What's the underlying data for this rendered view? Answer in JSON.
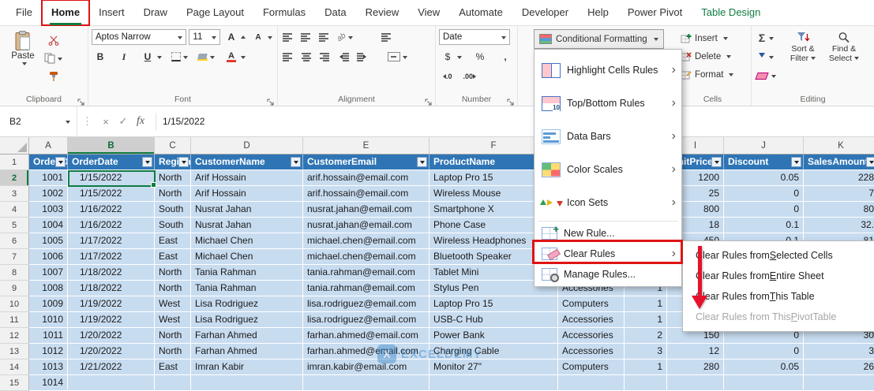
{
  "colors": {
    "accent_green": "#107C41",
    "annotation_red": "#DE1414",
    "table_header_blue": "#2F75B5",
    "row_fill": "#C8DCF0"
  },
  "glyphs": {
    "sigma": "Σ",
    "chevron": "›",
    "cancel": "×",
    "check": "✓",
    "dots": "⋮",
    "fx": "fx",
    "bold": "B",
    "italic": "I",
    "underline": "U",
    "dollar": "$",
    "percent": "%",
    "comma": ",",
    "inc_dec": ".0",
    "dec_dec": ".00",
    "font_a": "A",
    "orient": "ab",
    "watermark_logo": "X"
  },
  "tabs": [
    {
      "label": "File"
    },
    {
      "label": "Home",
      "selected": true,
      "annotated": true
    },
    {
      "label": "Insert"
    },
    {
      "label": "Draw"
    },
    {
      "label": "Page Layout"
    },
    {
      "label": "Formulas"
    },
    {
      "label": "Data"
    },
    {
      "label": "Review"
    },
    {
      "label": "View"
    },
    {
      "label": "Automate"
    },
    {
      "label": "Developer"
    },
    {
      "label": "Help"
    },
    {
      "label": "Power Pivot"
    },
    {
      "label": "Table Design",
      "contextual": true
    }
  ],
  "ribbon": {
    "clipboard": {
      "paste_label": "Paste",
      "group_label": "Clipboard"
    },
    "font": {
      "font_name": "Aptos Narrow",
      "font_size": "11",
      "group_label": "Font"
    },
    "alignment": {
      "group_label": "Alignment"
    },
    "number": {
      "format_selected": "Date",
      "group_label": "Number"
    },
    "styles": {
      "conditional_formatting_label": "Conditional Formatting"
    },
    "cells": {
      "insert_label": "Insert",
      "delete_label": "Delete",
      "format_label": "Format",
      "group_label": "Cells"
    },
    "editing": {
      "sort_filter_l1": "Sort &",
      "sort_filter_l2": "Filter",
      "find_select_l1": "Find &",
      "find_select_l2": "Select",
      "group_label": "Editing"
    }
  },
  "formula_bar": {
    "name_box": "B2",
    "value": "1/15/2022"
  },
  "cf_menu": {
    "items": [
      {
        "label": "Highlight Cells Rules",
        "icon": "highlight-cells",
        "submenu": true,
        "size": "large"
      },
      {
        "label": "Top/Bottom Rules",
        "icon": "top-bottom",
        "submenu": true,
        "size": "large"
      },
      {
        "label": "Data Bars",
        "icon": "data-bars",
        "submenu": true,
        "size": "large"
      },
      {
        "label": "Color Scales",
        "icon": "color-scales",
        "submenu": true,
        "size": "large"
      },
      {
        "label": "Icon Sets",
        "icon": "icon-sets",
        "submenu": true,
        "size": "large"
      },
      {
        "label": "New Rule...",
        "icon": "new-rule",
        "submenu": false,
        "size": "small"
      },
      {
        "label": "Clear Rules",
        "icon": "clear-rules",
        "submenu": true,
        "size": "small",
        "annotated": true
      },
      {
        "label": "Manage Rules...",
        "icon": "manage-rules",
        "submenu": false,
        "size": "small"
      }
    ]
  },
  "clear_rules_submenu": {
    "items": [
      {
        "pre": "Clear Rules from ",
        "key": "S",
        "post": "elected Cells",
        "disabled": false
      },
      {
        "pre": "Clear Rules from ",
        "key": "E",
        "post": "ntire Sheet",
        "disabled": false
      },
      {
        "pre": "Clear Rules from ",
        "key": "T",
        "post": "his Table",
        "disabled": false
      },
      {
        "pre": "Clear Rules from This ",
        "key": "P",
        "post": "ivotTable",
        "disabled": true
      }
    ]
  },
  "sheet": {
    "selected_cell": "B2",
    "selected_column": "B",
    "selected_row": 2,
    "column_letters": [
      "A",
      "B",
      "C",
      "D",
      "E",
      "F",
      "G",
      "H",
      "I",
      "J",
      "K"
    ],
    "table_headers": [
      "OrderID",
      "OrderDate",
      "Region",
      "CustomerName",
      "CustomerEmail",
      "ProductName",
      "",
      "",
      "UnitPrice",
      "Discount",
      "SalesAmount"
    ],
    "rows": [
      {
        "n": 2,
        "cells": [
          "1001",
          "1/15/2022",
          "North",
          "Arif Hossain",
          "arif.hossain@email.com",
          "Laptop Pro 15",
          "",
          "",
          "1200",
          "0.05",
          "228"
        ]
      },
      {
        "n": 3,
        "cells": [
          "1002",
          "1/15/2022",
          "North",
          "Arif Hossain",
          "arif.hossain@email.com",
          "Wireless Mouse",
          "",
          "",
          "25",
          "0",
          "7"
        ]
      },
      {
        "n": 4,
        "cells": [
          "1003",
          "1/16/2022",
          "South",
          "Nusrat Jahan",
          "nusrat.jahan@email.com",
          "Smartphone X",
          "",
          "",
          "800",
          "0",
          "80"
        ]
      },
      {
        "n": 5,
        "cells": [
          "1004",
          "1/16/2022",
          "South",
          "Nusrat Jahan",
          "nusrat.jahan@email.com",
          "Phone Case",
          "",
          "",
          "18",
          "0.1",
          "32."
        ]
      },
      {
        "n": 6,
        "cells": [
          "1005",
          "1/17/2022",
          "East",
          "Michael Chen",
          "michael.chen@email.com",
          "Wireless Headphones",
          "",
          "",
          "450",
          "0.1",
          "81"
        ]
      },
      {
        "n": 7,
        "cells": [
          "1006",
          "1/17/2022",
          "East",
          "Michael Chen",
          "michael.chen@email.com",
          "Bluetooth Speaker",
          "",
          "",
          "",
          "",
          ""
        ]
      },
      {
        "n": 8,
        "cells": [
          "1007",
          "1/18/2022",
          "North",
          "Tania Rahman",
          "tania.rahman@email.com",
          "Tablet Mini",
          "",
          "",
          "",
          "",
          ""
        ]
      },
      {
        "n": 9,
        "cells": [
          "1008",
          "1/18/2022",
          "North",
          "Tania Rahman",
          "tania.rahman@email.com",
          "Stylus Pen",
          "Accessories",
          "1",
          "",
          "",
          ""
        ]
      },
      {
        "n": 10,
        "cells": [
          "1009",
          "1/19/2022",
          "West",
          "Lisa Rodriguez",
          "lisa.rodriguez@email.com",
          "Laptop Pro 15",
          "Computers",
          "1",
          "",
          "",
          ""
        ]
      },
      {
        "n": 11,
        "cells": [
          "1010",
          "1/19/2022",
          "West",
          "Lisa Rodriguez",
          "lisa.rodriguez@email.com",
          "USB-C Hub",
          "Accessories",
          "1",
          "",
          "",
          ""
        ]
      },
      {
        "n": 12,
        "cells": [
          "1011",
          "1/20/2022",
          "North",
          "Farhan Ahmed",
          "farhan.ahmed@email.com",
          "Power Bank",
          "Accessories",
          "2",
          "150",
          "0",
          "30"
        ]
      },
      {
        "n": 13,
        "cells": [
          "1012",
          "1/20/2022",
          "North",
          "Farhan Ahmed",
          "farhan.ahmed@email.com",
          "Charging Cable",
          "Accessories",
          "3",
          "12",
          "0",
          "3"
        ]
      },
      {
        "n": 14,
        "cells": [
          "1013",
          "1/21/2022",
          "East",
          "Imran Kabir",
          "imran.kabir@email.com",
          "Monitor 27\"",
          "Computers",
          "1",
          "280",
          "0.05",
          "26"
        ]
      },
      {
        "n": 15,
        "cells": [
          "1014",
          "",
          "",
          "",
          "",
          "",
          "",
          "",
          "",
          "",
          ""
        ]
      }
    ]
  },
  "watermark": "EXCELDEMY"
}
